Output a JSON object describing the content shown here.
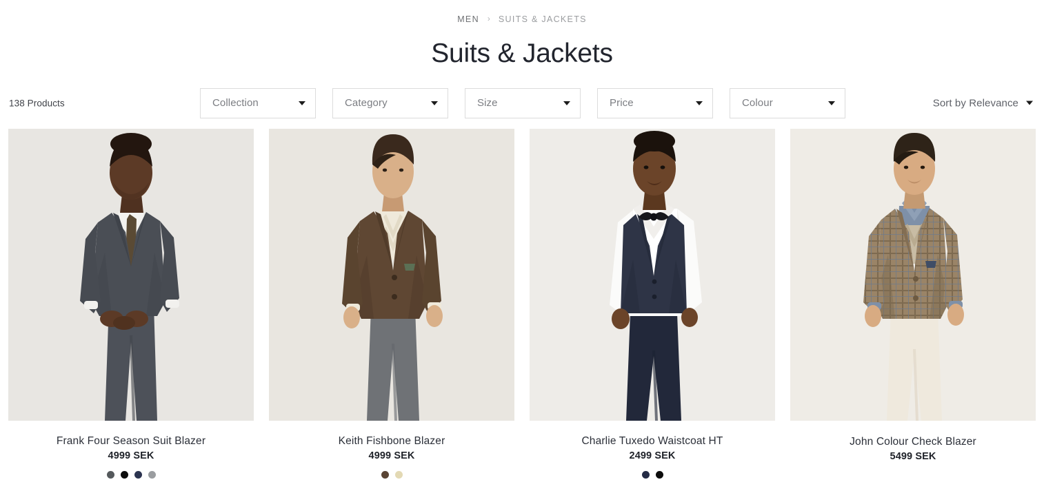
{
  "breadcrumb": {
    "items": [
      {
        "label": "MEN",
        "current": false
      },
      {
        "label": "SUITS & JACKETS",
        "current": true
      }
    ],
    "separator": "›"
  },
  "page": {
    "title": "Suits & Jackets"
  },
  "toolbar": {
    "product_count": "138 Products",
    "filters": [
      {
        "name": "collection",
        "label": "Collection"
      },
      {
        "name": "category",
        "label": "Category"
      },
      {
        "name": "size",
        "label": "Size"
      },
      {
        "name": "price",
        "label": "Price"
      },
      {
        "name": "colour",
        "label": "Colour"
      }
    ],
    "sort": {
      "label": "Sort by Relevance",
      "icon": "chevron-down-icon"
    }
  },
  "products": [
    {
      "title": "Frank Four Season Suit Blazer",
      "price": "4999 SEK",
      "photo_bg": "#e8e6e2",
      "swatches": [
        "#55595c",
        "#0d0d0d",
        "#2c3450",
        "#9a9da0"
      ],
      "model": {
        "skin": "#5c3a26",
        "hair": "#23160f",
        "jacket": "#4a4e55",
        "jacket_dark": "#3b3f46",
        "shirt": "#f3f2ef",
        "tie": "#5a4a34",
        "trousers": "#4d5159"
      }
    },
    {
      "title": "Keith Fishbone Blazer",
      "price": "4999 SEK",
      "photo_bg": "#e9e6e0",
      "swatches": [
        "#5a4434",
        "#e3d9b4"
      ],
      "model": {
        "skin": "#d9b089",
        "hair": "#3a291d",
        "jacket": "#5d4staff",
        "jacket_color": "#604staff",
        "jacket_main": "#5f4733",
        "jacket_dark": "#4c3928",
        "shirt": "#efe9da",
        "tie": "#e2dac6",
        "trousers": "#6f7276"
      }
    },
    {
      "title": "Charlie Tuxedo Waistcoat HT",
      "price": "2499 SEK",
      "photo_bg": "#eeece8",
      "swatches": [
        "#242b45",
        "#0d0d0d"
      ],
      "model": {
        "skin": "#6b4429",
        "hair": "#1b120c",
        "jacket": "#2e3446",
        "jacket_dark": "#242a3a",
        "shirt": "#fbfbfa",
        "tie": "#17171c",
        "trousers": "#22283a"
      }
    },
    {
      "title": "John Colour Check Blazer",
      "price": "5499 SEK",
      "swatches": [],
      "photo_bg": "#efece6",
      "model": {
        "skin": "#d8ab82",
        "hair": "#2e2318",
        "jacket": "#9a8467",
        "jacket_dark": "#836e53",
        "shirt": "#7e90a8",
        "tie": "#c8bca4",
        "trousers": "#efe9dd"
      }
    }
  ]
}
